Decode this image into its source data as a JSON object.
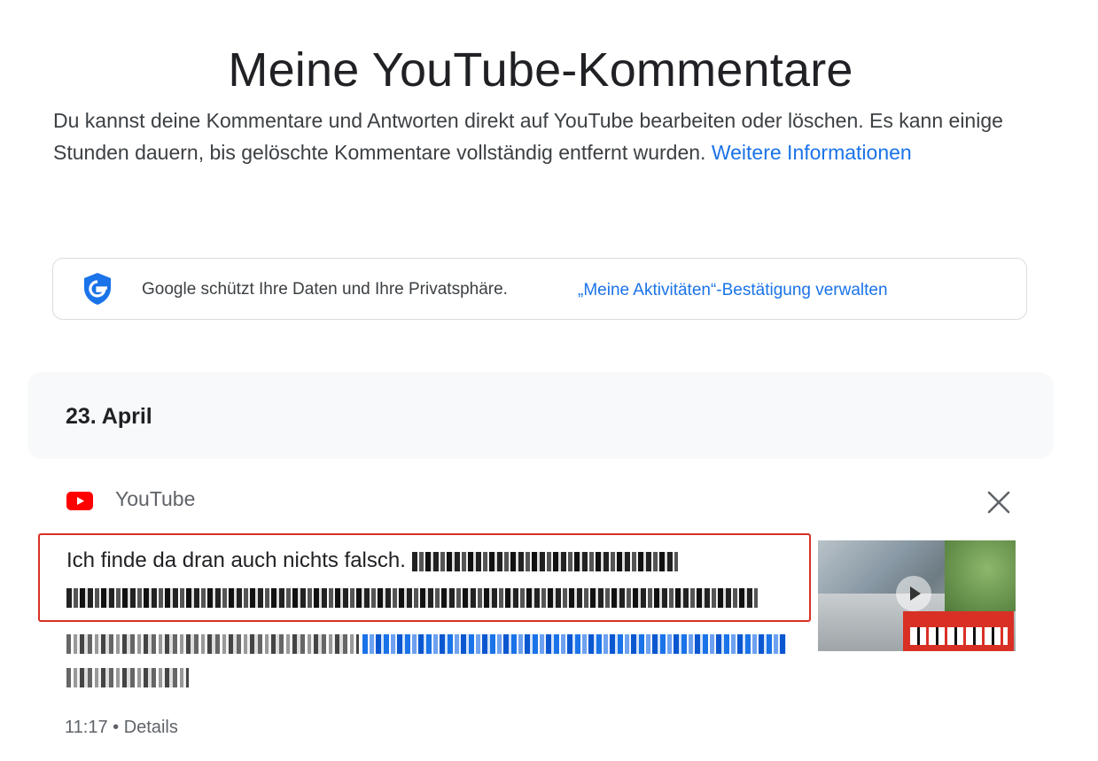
{
  "page": {
    "title": "Meine YouTube-Kommentare",
    "intro_text": "Du kannst deine Kommentare und Antworten direkt auf YouTube bearbeiten oder löschen. Es kann einige Stunden dauern, bis gelöschte Kommentare vollständig entfernt wurden.",
    "intro_link": "Weitere Informationen"
  },
  "privacy": {
    "text": "Google schützt Ihre Daten und Ihre Privatsphäre.",
    "link": "„Meine Aktivitäten“-Bestätigung verwalten",
    "icon": "google-shield-icon"
  },
  "activity": {
    "date": "23. April",
    "product": "YouTube",
    "comment_visible_text": "Ich finde da dran auch nichts falsch.",
    "time": "11:17",
    "separator": "•",
    "details": "Details"
  },
  "colors": {
    "accent": "#1a73e8",
    "highlight_border": "#d93025",
    "youtube_red": "#ff0000"
  }
}
